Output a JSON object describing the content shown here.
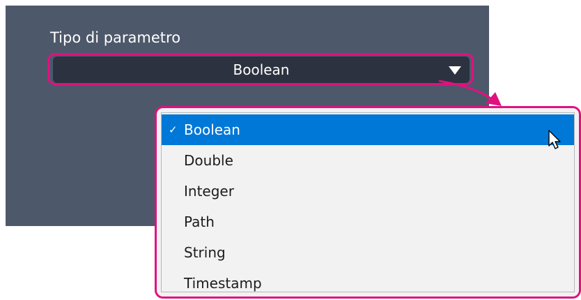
{
  "field": {
    "label": "Tipo di parametro",
    "selected_value": "Boolean"
  },
  "dropdown": {
    "options": [
      {
        "label": "Boolean",
        "selected": true,
        "check": "✓"
      },
      {
        "label": "Double",
        "selected": false
      },
      {
        "label": "Integer",
        "selected": false
      },
      {
        "label": "Path",
        "selected": false
      },
      {
        "label": "String",
        "selected": false
      },
      {
        "label": "Timestamp",
        "selected": false
      }
    ]
  },
  "icons": {
    "dropdown_arrow": "chevron-down-icon",
    "mouse_cursor": "mouse-pointer-icon",
    "checkmark": "checkmark-icon"
  },
  "colors": {
    "panel_background": "#4e586b",
    "select_background": "#2d3240",
    "highlight_outline": "#e0117f",
    "selected_option": "#0078d7",
    "menu_background": "#f2f2f2"
  }
}
